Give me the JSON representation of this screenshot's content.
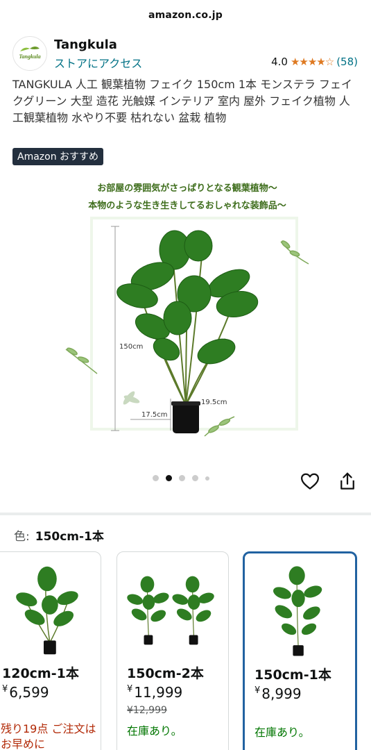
{
  "browser": {
    "url": "amazon.co.jp"
  },
  "store": {
    "name": "Tangkula",
    "logo_text": "Tangkula",
    "link_label": "ストアにアクセス",
    "rating": "4.0",
    "stars": "★★★★☆",
    "review_count": "(58)"
  },
  "product": {
    "title": "TANGKULA 人工 観葉植物 フェイク 150cm 1本 モンステラ フェイクグリーン 大型 造花 光触媒 インテリア 室内 屋外 フェイク植物 人工観葉植物 水やり不要 枯れない 盆栽 植物",
    "badge": "Amazon おすすめ"
  },
  "hero": {
    "headline1": "お部屋の雰囲気がさっぱりとなる観葉植物～",
    "headline2": "本物のような生き生きしてるおしゃれな装飾品～",
    "height_label": "150cm",
    "pot_top_label": "19.5cm",
    "pot_bottom_label": "17.5cm"
  },
  "carousel": {
    "total": 5,
    "active": 2
  },
  "options": {
    "label": "色:",
    "selected": "150cm-1本",
    "variants": [
      {
        "name": "120cm-1本",
        "currency": "¥",
        "price": "6,599",
        "low_stock": "残り19点 ご注文はお早めに"
      },
      {
        "name": "150cm-2本",
        "currency": "¥",
        "price": "11,999",
        "old_price": "¥12,999",
        "stock": "在庫あり。"
      },
      {
        "name": "150cm-1本",
        "currency": "¥",
        "price": "8,999",
        "stock": "在庫あり。"
      }
    ]
  },
  "icons": {
    "favorite": "heart-icon",
    "share": "share-icon"
  },
  "colors": {
    "link": "#007185",
    "star": "#de7921",
    "badge_bg": "#232f3e",
    "selected_border": "#2162a1",
    "in_stock": "#007600",
    "low_stock": "#b12704"
  }
}
